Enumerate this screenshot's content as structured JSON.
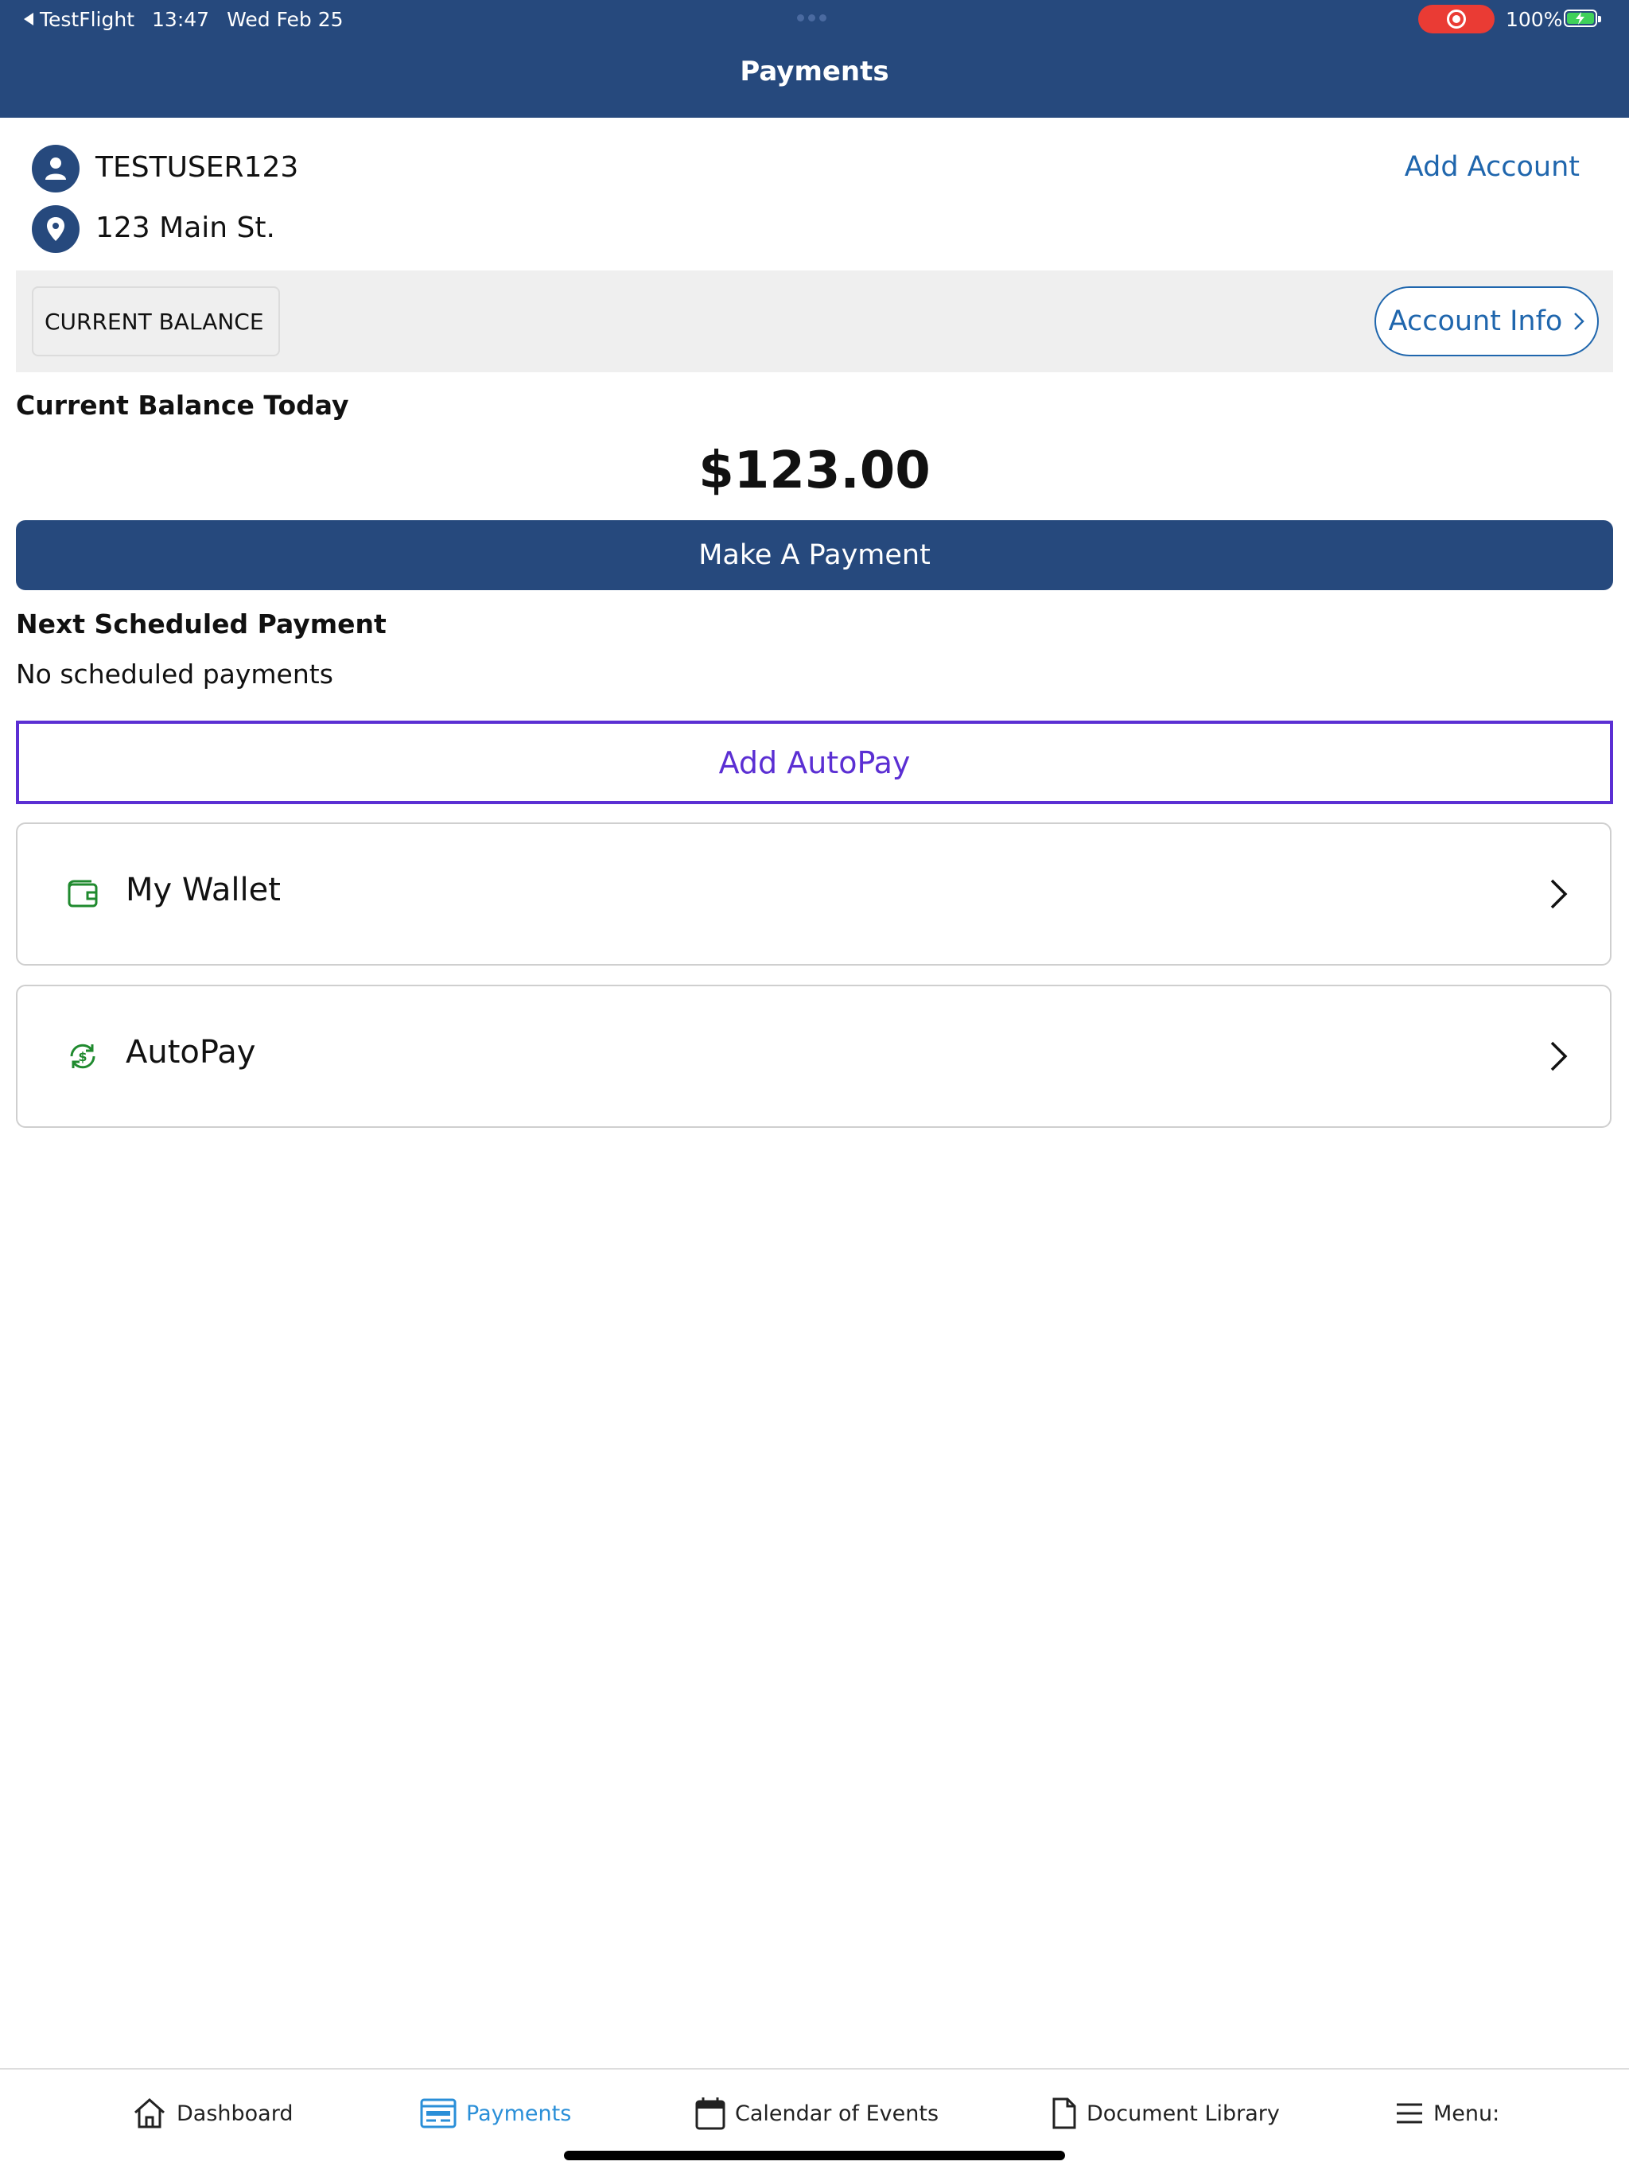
{
  "status_bar": {
    "back_app": "TestFlight",
    "time": "13:47",
    "date": "Wed Feb 25",
    "battery": "100%"
  },
  "header": {
    "title": "Payments"
  },
  "account": {
    "username": "TESTUSER123",
    "address": "123 Main St.",
    "add_account_label": "Add Account"
  },
  "balance": {
    "tab_label": "CURRENT BALANCE",
    "account_info_label": "Account Info",
    "heading": "Current Balance Today",
    "amount": "$123.00",
    "make_payment_label": "Make A Payment"
  },
  "scheduled": {
    "heading": "Next Scheduled Payment",
    "empty_text": "No scheduled payments",
    "add_autopay_label": "Add AutoPay"
  },
  "cards": [
    {
      "label": "My Wallet",
      "icon": "wallet-icon"
    },
    {
      "label": "AutoPay",
      "icon": "autopay-icon"
    }
  ],
  "tabs": [
    {
      "label": "Dashboard",
      "icon": "home-icon"
    },
    {
      "label": "Payments",
      "icon": "payments-icon",
      "active": true
    },
    {
      "label": "Calendar of Events",
      "icon": "calendar-icon"
    },
    {
      "label": "Document Library",
      "icon": "document-icon"
    },
    {
      "label": "Menu:",
      "icon": "menu-icon"
    }
  ],
  "colors": {
    "brand": "#26497d",
    "link": "#1f66ad",
    "autopay_outline": "#5b2fd3",
    "icon_green": "#1f8a2e",
    "active_tab": "#2a8fd8"
  }
}
